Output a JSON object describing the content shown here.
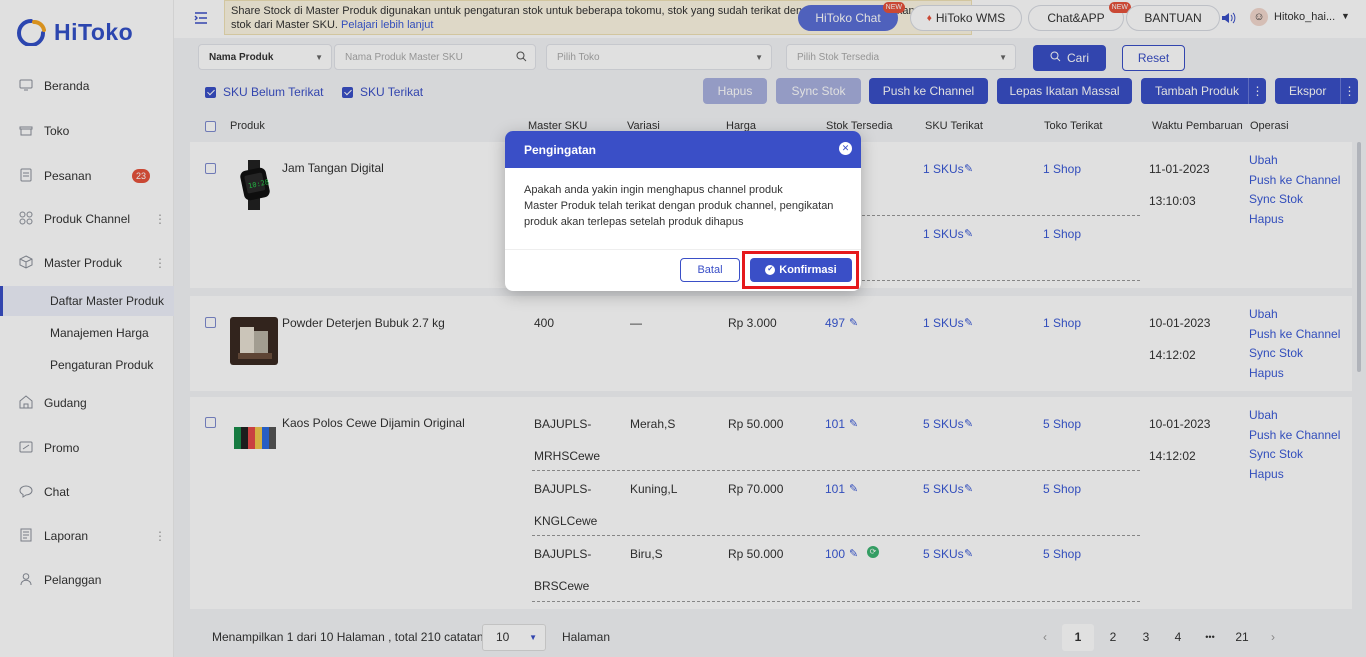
{
  "brand": {
    "name": "HiToko"
  },
  "sidebar": {
    "items": [
      {
        "label": "Beranda",
        "icon": "monitor-icon"
      },
      {
        "label": "Toko",
        "icon": "store-icon"
      },
      {
        "label": "Pesanan",
        "icon": "clipboard-icon",
        "badge": "23"
      },
      {
        "label": "Produk Channel",
        "icon": "grid-icon"
      },
      {
        "label": "Master Produk",
        "icon": "box-icon"
      },
      {
        "label": "Gudang",
        "icon": "warehouse-icon"
      },
      {
        "label": "Promo",
        "icon": "promo-icon"
      },
      {
        "label": "Chat",
        "icon": "chat-icon"
      },
      {
        "label": "Laporan",
        "icon": "report-icon"
      },
      {
        "label": "Pelanggan",
        "icon": "user-icon"
      }
    ],
    "subitems": [
      "Daftar Master Produk",
      "Manajemen Harga",
      "Pengaturan Produk"
    ]
  },
  "topbar": {
    "notice_text": "Share Stock di Master Produk digunakan untuk pengaturan stok untuk beberapa tokomu, stok yang sudah terikat dengan channel SKU akan mengikuti stok dari Master SKU.",
    "notice_link": "Pelajari lebih lanjut",
    "hitoko_chat": "HiToko Chat",
    "hitoko_wms": "HiToko WMS",
    "chat_app": "Chat&APP",
    "bantuan": "BANTUAN",
    "new_badge": "NEW",
    "user_name": "Hitoko_hai..."
  },
  "filters": {
    "field_select": "Nama Produk",
    "name_placeholder": "Nama Produk Master SKU",
    "store_placeholder": "Pilih Toko",
    "stock_placeholder": "Pilih Stok Tersedia",
    "search_label": "Cari",
    "reset_label": "Reset"
  },
  "toolbar": {
    "sku_unbound": "SKU Belum Terikat",
    "sku_bound": "SKU Terikat",
    "hapus": "Hapus",
    "sync_stok": "Sync Stok",
    "push_channel": "Push ke Channel",
    "lepas_ikatan": "Lepas Ikatan Massal",
    "tambah_produk": "Tambah Produk",
    "ekspor": "Ekspor"
  },
  "table": {
    "headers": [
      "Produk",
      "Master SKU",
      "Variasi",
      "Harga",
      "Stok Tersedia",
      "SKU Terikat",
      "Toko Terikat",
      "Waktu Pembaruan",
      "Operasi"
    ],
    "operations": [
      "Ubah",
      "Push ke Channel",
      "Sync Stok",
      "Hapus"
    ],
    "rows": [
      {
        "name": "Jam Tangan Digital",
        "date": "11-01-2023",
        "time": "13:10:03",
        "variants": [
          {
            "sku_bound": "1 SKUs",
            "store": "1 Shop"
          },
          {
            "sku_bound": "1 SKUs",
            "store": "1 Shop"
          }
        ]
      },
      {
        "name": "Powder Deterjen Bubuk 2.7 kg",
        "date": "10-01-2023",
        "time": "14:12:02",
        "variants": [
          {
            "sku": "400",
            "var": "—",
            "price": "Rp 3.000",
            "stock": "497",
            "sku_bound": "1 SKUs",
            "store": "1 Shop"
          }
        ]
      },
      {
        "name": "Kaos Polos Cewe Dijamin Original",
        "date": "10-01-2023",
        "time": "14:12:02",
        "variants": [
          {
            "sku1": "BAJUPLS-",
            "sku2": "MRHSCewe",
            "var": "Merah,S",
            "price": "Rp 50.000",
            "stock": "101",
            "sku_bound": "5 SKUs",
            "store": "5 Shop"
          },
          {
            "sku1": "BAJUPLS-",
            "sku2": "KNGLCewe",
            "var": "Kuning,L",
            "price": "Rp 70.000",
            "stock": "101",
            "sku_bound": "5 SKUs",
            "store": "5 Shop"
          },
          {
            "sku1": "BAJUPLS-",
            "sku2": "BRSCewe",
            "var": "Biru,S",
            "price": "Rp 50.000",
            "stock": "100",
            "sku_bound": "5 SKUs",
            "store": "5 Shop"
          }
        ]
      }
    ]
  },
  "pagination": {
    "summary": "Menampilkan 1 dari 10 Halaman , total 210 catatan",
    "page_size": "10",
    "halaman": "Halaman",
    "pages": [
      "1",
      "2",
      "3",
      "4",
      "•••",
      "21"
    ]
  },
  "modal": {
    "title": "Pengingatan",
    "line1": "Apakah anda yakin ingin menghapus channel produk",
    "line2": "Master Produk telah terikat dengan produk channel, pengikatan produk akan terlepas setelah produk dihapus",
    "cancel": "Batal",
    "confirm": "Konfirmasi"
  },
  "colors": {
    "accent": "#3a4fc7",
    "highlight": "#e5191c",
    "notice_bg": "#fdf6e3",
    "badge": "#e6533c"
  }
}
